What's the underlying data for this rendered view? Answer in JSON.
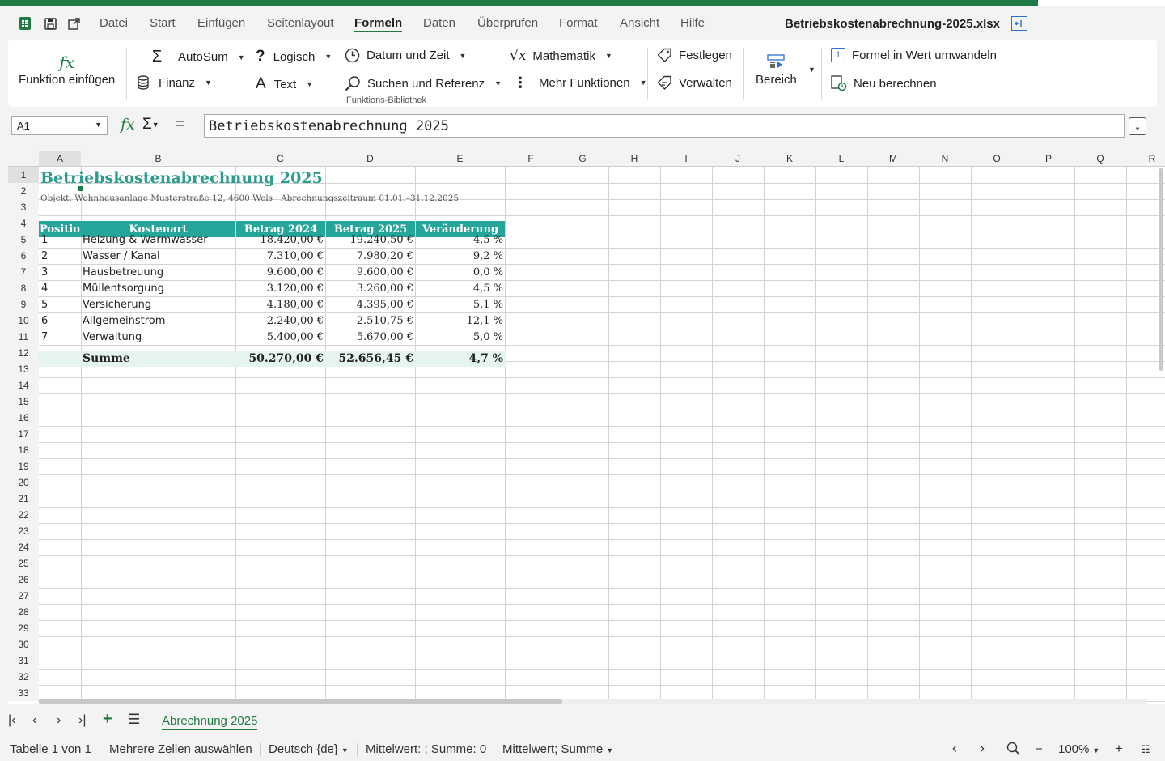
{
  "menu": {
    "tabs": [
      "Datei",
      "Start",
      "Einfügen",
      "Seitenlayout",
      "Formeln",
      "Daten",
      "Überprüfen",
      "Format",
      "Ansicht",
      "Hilfe"
    ],
    "active_tab": "Formeln",
    "document_title": "Betriebskostenabrechnung-2025.xlsx"
  },
  "ribbon": {
    "insert_function": "Funktion einfügen",
    "autosum": "AutoSum",
    "finance": "Finanz",
    "logical": "Logisch",
    "text": "Text",
    "date_time": "Datum und Zeit",
    "lookup": "Suchen und Referenz",
    "math": "Mathematik",
    "more_functions": "Mehr Funktionen",
    "group_label": "Funktions-Bibliothek",
    "define": "Festlegen",
    "manage": "Verwalten",
    "range": "Bereich",
    "convert_formula": "Formel in Wert umwandeln",
    "recalculate": "Neu berechnen"
  },
  "formula_bar": {
    "name_box": "A1",
    "content": "Betriebskostenabrechnung 2025"
  },
  "columns": [
    "A",
    "B",
    "C",
    "D",
    "E",
    "F",
    "G",
    "H",
    "I",
    "J",
    "K",
    "L",
    "M",
    "N",
    "O",
    "P",
    "Q",
    "R"
  ],
  "rows": [
    "1",
    "2",
    "3",
    "4",
    "5",
    "6",
    "7",
    "8",
    "9",
    "10",
    "11",
    "12",
    "13",
    "14",
    "15",
    "16",
    "17",
    "18",
    "19",
    "20",
    "21",
    "22",
    "23",
    "24",
    "25",
    "26",
    "27",
    "28",
    "29",
    "30",
    "31",
    "32",
    "33"
  ],
  "sheet": {
    "title": "Betriebskostenabrechnung 2025",
    "subtitle": "Objekt: Wohnhausanlage Musterstraße 12, 4600 Wels  ·  Abrechnungszeitraum 01.01.–31.12.2025",
    "headers": [
      "Position",
      "Kostenart",
      "Betrag 2024",
      "Betrag 2025",
      "Veränderung"
    ],
    "data": [
      {
        "pos": "1",
        "name": "Heizung & Warmwasser",
        "y2024": "18.420,00 €",
        "y2025": "19.240,50 €",
        "change": "4,5 %"
      },
      {
        "pos": "2",
        "name": "Wasser / Kanal",
        "y2024": "7.310,00 €",
        "y2025": "7.980,20 €",
        "change": "9,2 %"
      },
      {
        "pos": "3",
        "name": "Hausbetreuung",
        "y2024": "9.600,00 €",
        "y2025": "9.600,00 €",
        "change": "0,0 %"
      },
      {
        "pos": "4",
        "name": "Müllentsorgung",
        "y2024": "3.120,00 €",
        "y2025": "3.260,00 €",
        "change": "4,5 %"
      },
      {
        "pos": "5",
        "name": "Versicherung",
        "y2024": "4.180,00 €",
        "y2025": "4.395,00 €",
        "change": "5,1 %"
      },
      {
        "pos": "6",
        "name": "Allgemeinstrom",
        "y2024": "2.240,00 €",
        "y2025": "2.510,75 €",
        "change": "12,1 %"
      },
      {
        "pos": "7",
        "name": "Verwaltung",
        "y2024": "5.400,00 €",
        "y2025": "5.670,00 €",
        "change": "5,0 %"
      }
    ],
    "sum": {
      "label": "Summe",
      "y2024": "50.270,00 €",
      "y2025": "52.656,45 €",
      "change": "4,7 %"
    }
  },
  "sheet_tabs": {
    "active": "Abrechnung 2025"
  },
  "status": {
    "sheet_info": "Tabelle 1 von 1",
    "selection_mode": "Mehrere Zellen auswählen",
    "language": "Deutsch {de}",
    "stats": "Mittelwert: ; Summe: 0",
    "stats_select": "Mittelwert; Summe",
    "zoom": "100%"
  },
  "colors": {
    "brand": "#1f7a45",
    "header_fill": "#26a69a",
    "title_text": "#2a9d8f",
    "sum_fill": "#e6f4f1"
  }
}
